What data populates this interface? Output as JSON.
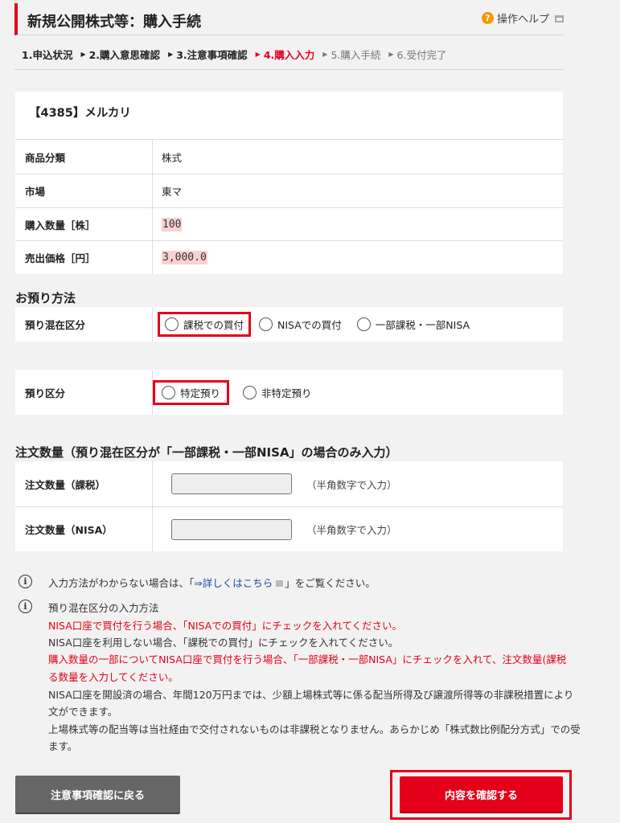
{
  "header": {
    "title": "新規公開株式等：購入手続",
    "help_label": "操作ヘルプ",
    "help_icon": "question-icon"
  },
  "steps": [
    {
      "label": "1.申込状況",
      "state": "done"
    },
    {
      "label": "2.購入意思確認",
      "state": "done"
    },
    {
      "label": "3.注意事項確認",
      "state": "done"
    },
    {
      "label": "4.購入入力",
      "state": "current"
    },
    {
      "label": "5.購入手続",
      "state": "future"
    },
    {
      "label": "6.受付完了",
      "state": "future"
    }
  ],
  "product": {
    "name": "【4385】メルカリ",
    "rows": [
      {
        "label": "商品分類",
        "value": "株式"
      },
      {
        "label": "市場",
        "value": "東マ"
      },
      {
        "label": "購入数量［株］",
        "value": "100"
      },
      {
        "label": "売出価格［円］",
        "value": "3,000.0"
      }
    ]
  },
  "deposit": {
    "section_title": "お預り方法",
    "mixed_label": "預り混在区分",
    "mixed_options": [
      "課税での買付",
      "NISAでの買付",
      "一部課税・一部NISA"
    ],
    "type_label": "預り区分",
    "type_options": [
      "特定預り",
      "非特定預り"
    ]
  },
  "order_qty": {
    "section_title": "注文数量（預り混在区分が「一部課税・一部NISA」の場合のみ入力）",
    "taxable_label": "注文数量（課税）",
    "nisa_label": "注文数量（NISA）",
    "hint": "（半角数字で入力）"
  },
  "notes": {
    "note1_prefix": "入力方法がわからない場合は、「",
    "note1_link": "⇒詳しくはこちら",
    "note1_suffix": "」をご覧ください。",
    "note2_title": "預り混在区分の入力方法",
    "line_nisa_buy": "NISA口座で買付を行う場合、「NISAでの買付」にチェックを入れてください。",
    "line_no_nisa": "NISA口座を利用しない場合、「課税での買付」にチェックを入れてください。",
    "line_partial_1": "購入数量の一部についてNISA口座で買付を行う場合、「一部課税・一部NISA」にチェックを入れて、注文数量(課税",
    "line_partial_2": "る数量を入力してください。",
    "line_open_1": "NISA口座を開設済の場合、年間120万円までは、少額上場株式等に係る配当所得及び譲渡所得等の非課税措置により",
    "line_open_2": "文ができます。",
    "line_div_1": "上場株式等の配当等は当社経由で交付されないものは非課税となりません。あらかじめ「株式数比例配分方式」での受",
    "line_div_2": "ます。"
  },
  "buttons": {
    "back": "注意事項確認に戻る",
    "confirm": "内容を確認する"
  },
  "colors": {
    "accent": "#e4001b",
    "highlight": "#fbd1d1",
    "help": "#f39800"
  }
}
